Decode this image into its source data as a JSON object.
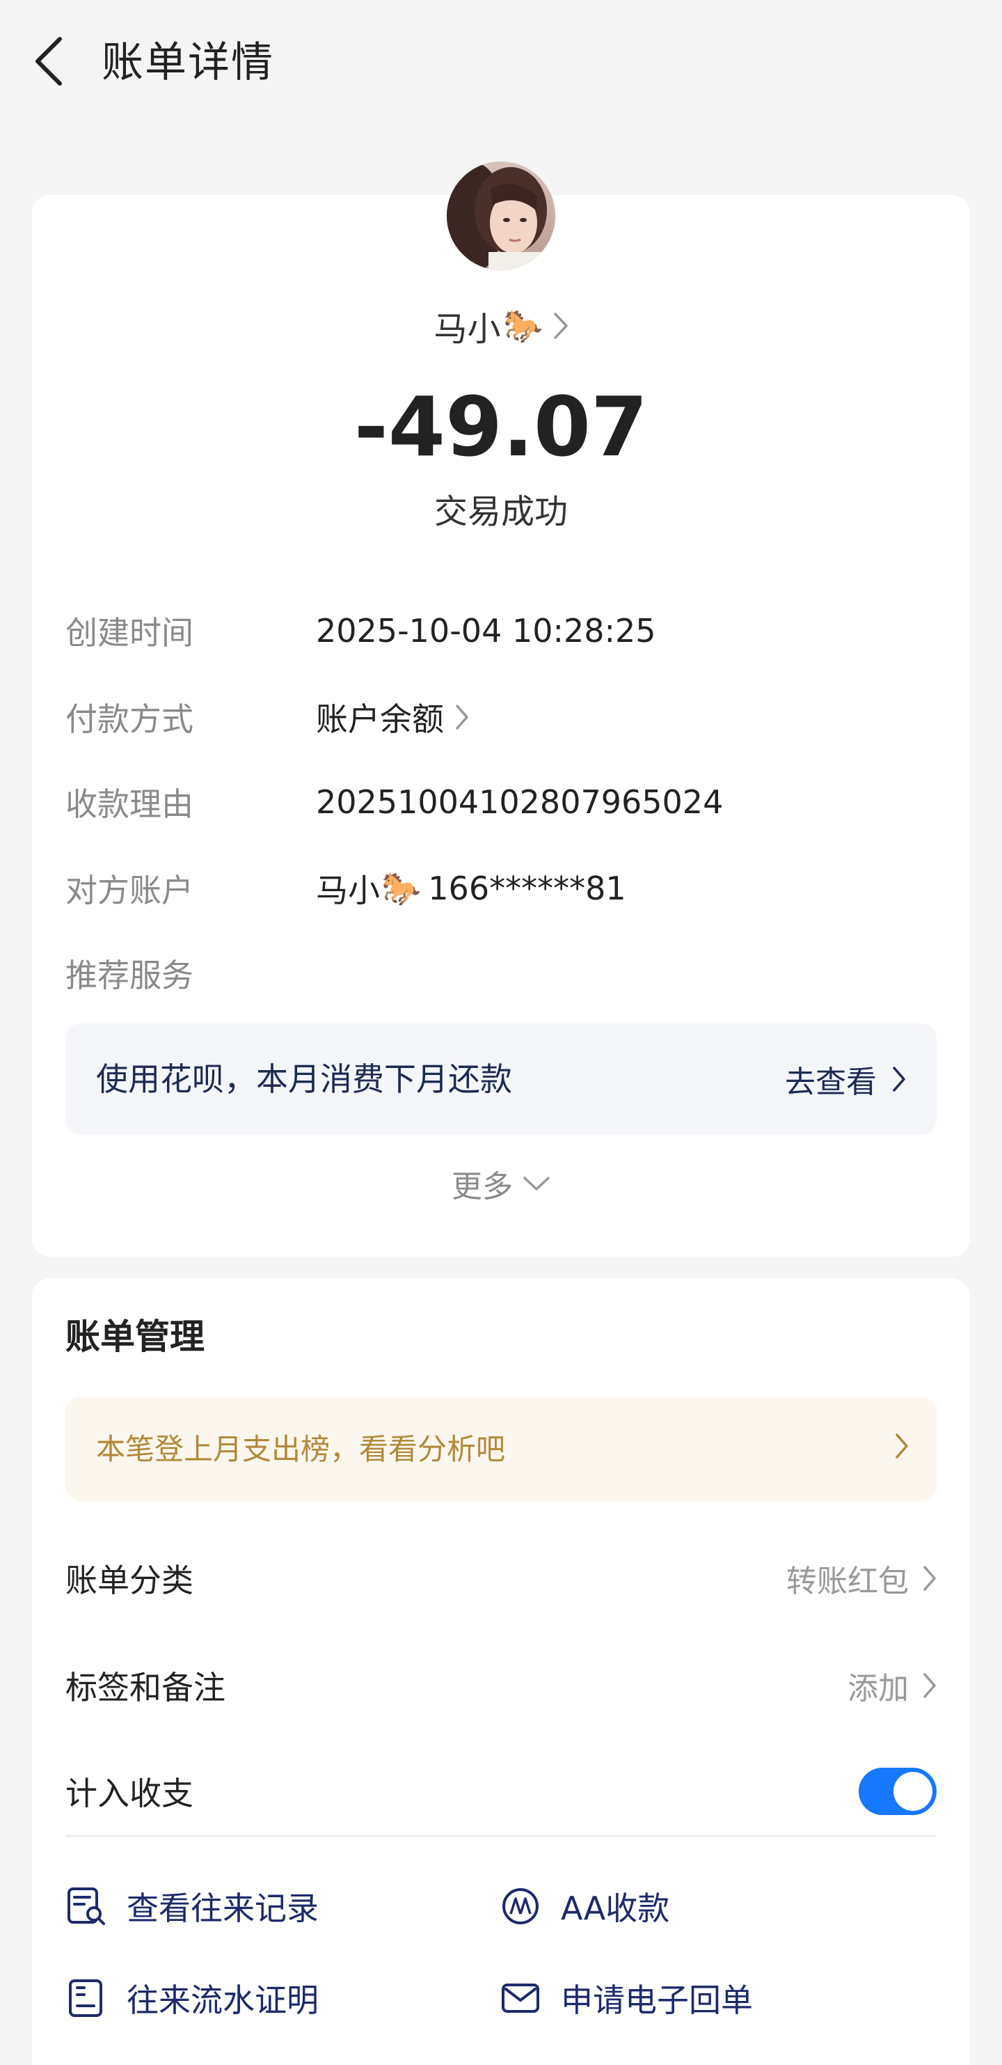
{
  "header": {
    "title": "账单详情"
  },
  "payee": {
    "name": "马小",
    "emoji": "🐎",
    "amount": "-49.07",
    "status": "交易成功"
  },
  "details": [
    {
      "label": "创建时间",
      "value": "2025-10-04 10:28:25"
    },
    {
      "label": "付款方式",
      "value": "账户余额"
    },
    {
      "label": "收款理由",
      "value": "20251004102807965024"
    },
    {
      "label": "对方账户",
      "value_name": "马小",
      "value_emoji": "🐎",
      "value_account": "166******81"
    },
    {
      "label": "推荐服务"
    }
  ],
  "promo": {
    "text": "使用花呗，本月消费下月还款",
    "action": "去查看"
  },
  "more_label": "更多",
  "bill_management": {
    "title": "账单管理",
    "analysis_text": "本笔登上月支出榜，看看分析吧",
    "category_label": "账单分类",
    "category_value": "转账红包",
    "tags_label": "标签和备注",
    "tags_value": "添加",
    "count_label": "计入收支",
    "count_enabled": true
  },
  "actions": [
    {
      "label": "查看往来记录",
      "icon": "record-search-icon"
    },
    {
      "label": "AA收款",
      "icon": "aa-icon"
    },
    {
      "label": "往来流水证明",
      "icon": "statement-icon"
    },
    {
      "label": "申请电子回单",
      "icon": "envelope-icon"
    }
  ],
  "colors": {
    "background": "#f5f5f5",
    "card": "#ffffff",
    "accent_blue": "#1677ff",
    "promo_text": "#1d2a55",
    "analysis_text": "#b38838"
  }
}
